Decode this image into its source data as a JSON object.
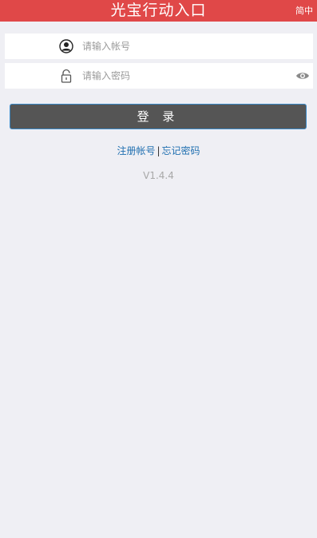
{
  "header": {
    "title": "光宝行动入口",
    "lang_switch": "简中"
  },
  "login_form": {
    "username_placeholder": "请输入帐号",
    "password_placeholder": "请输入密码",
    "username_value": "",
    "password_value": "",
    "login_label": "登 录"
  },
  "links": {
    "register": "注册帐号",
    "separator": "|",
    "forgot_password": "忘记密码"
  },
  "version": "V1.4.4",
  "icons": {
    "username": "user-icon",
    "password": "lock-icon",
    "toggle_password": "eye-icon"
  },
  "colors": {
    "header_bg": "#e04848",
    "page_bg": "#efeff4",
    "button_bg": "#555555",
    "button_border": "#3a8ac8",
    "link": "#1f6fb0"
  }
}
